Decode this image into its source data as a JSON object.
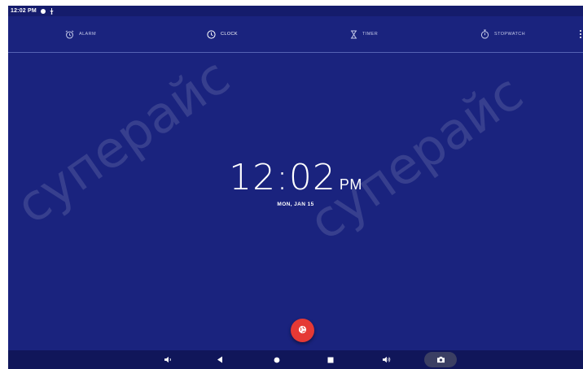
{
  "statusbar": {
    "time": "12:02 PM",
    "icons": [
      "notification-dot-icon",
      "usb-icon"
    ]
  },
  "tabs": [
    {
      "label": "ALARM",
      "icon": "alarm-clock-icon",
      "active": false
    },
    {
      "label": "CLOCK",
      "icon": "clock-icon",
      "active": true
    },
    {
      "label": "TIMER",
      "icon": "hourglass-icon",
      "active": false
    },
    {
      "label": "STOPWATCH",
      "icon": "stopwatch-icon",
      "active": false
    }
  ],
  "clock": {
    "time": "12:02",
    "ampm": "PM",
    "date": "MON, JAN 15"
  },
  "fab": {
    "icon": "globe-icon",
    "color": "#e53935"
  },
  "navbar": {
    "buttons": [
      "volume-down-icon",
      "back-icon",
      "home-icon",
      "recents-icon",
      "volume-up-icon",
      "camera-icon"
    ]
  },
  "watermark": {
    "text": "суперайс"
  },
  "colors": {
    "background": "#1a237e",
    "accent": "#e53935",
    "text": "#ffffff"
  }
}
